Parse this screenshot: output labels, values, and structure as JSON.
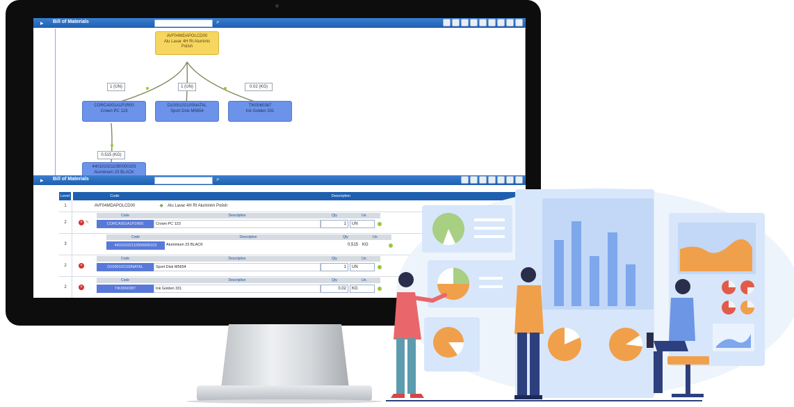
{
  "app": {
    "panel_title": "Bill of Materials",
    "table_panel_title": "Bill of Materials"
  },
  "tree": {
    "root": {
      "code": "AVF04MDAPOLCD00",
      "desc_line1": "Alu Lavar 4H Rt Aluminis",
      "desc_line2": "Polish"
    },
    "children": [
      {
        "qty": "1 (UN)",
        "code": "CORCA001A1P1R00",
        "desc": "Crown PC 123"
      },
      {
        "qty": "1 (UN)",
        "code": "D100010210SNATAL",
        "desc": "Sport Disk M5654"
      },
      {
        "qty": "0.02 (KG)",
        "code": "TIK0060387",
        "desc": "Ink Golden 331"
      }
    ],
    "grandchild": {
      "qty": "0.515 (KG)",
      "code": "4401010211050000103",
      "desc": "Aluminium 23 BLACK"
    }
  },
  "table": {
    "headers": {
      "level": "Level",
      "code": "Code",
      "description": "Description"
    },
    "sub_headers": {
      "code": "Code",
      "description": "Description",
      "qty": "Qty",
      "unit": "Un."
    },
    "root_row": {
      "level": "1",
      "code": "AVF04MDAPOLCD00",
      "desc": "Alu Lavar 4H Rt Aluminim Polish"
    },
    "rows": [
      {
        "level": "2",
        "code": "CORCA001A1P1R00",
        "desc": "Crown PC 123",
        "qty": "1",
        "unit": "UN"
      },
      {
        "level": "3",
        "code": "44010102110500000103",
        "desc": "Aluminium 23 BLACK",
        "qty": "0,515",
        "unit": "KG"
      },
      {
        "level": "2",
        "code": "D1000102100NATAL",
        "desc": "Sport Disk M5654",
        "qty": "1",
        "unit": "UN"
      },
      {
        "level": "2",
        "code": "TIK0060387",
        "desc": "Ink Golden 331",
        "qty": "0,02",
        "unit": "KG"
      }
    ]
  },
  "colors": {
    "header_blue": "#1e5fb0",
    "node_yellow": "#f7d660",
    "node_blue": "#6c93ea",
    "accent_orange": "#f0a04b",
    "accent_light_blue": "#c9dcf7"
  }
}
